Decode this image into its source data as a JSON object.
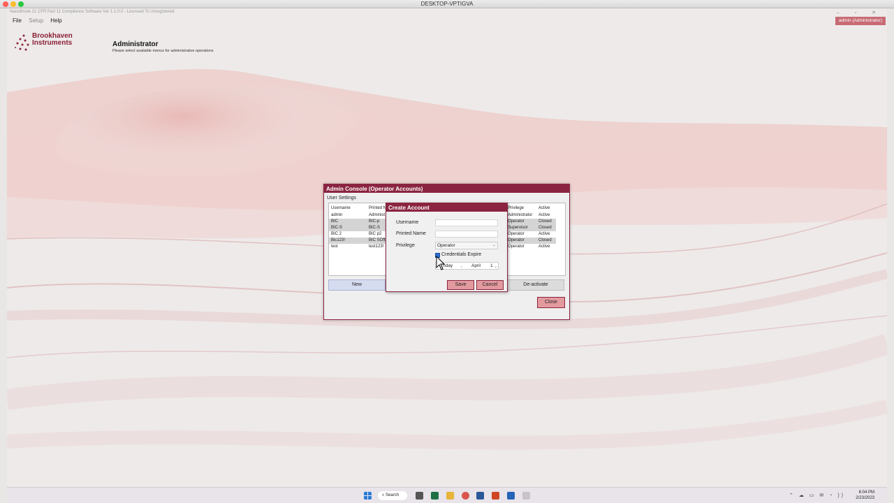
{
  "mac_window": {
    "title": "DESKTOP-VPTIGVA"
  },
  "app": {
    "window_title": "NanoBrook 21 CFR Part 11 Compliance Software Ver 1.1.0.0 - Licensed To Unregistered",
    "window_controls": "– ▫ ✕",
    "menu": {
      "file": "File",
      "setup": "Setup",
      "help": "Help"
    },
    "user_badge": "admin (Administrator)",
    "logo": {
      "line1": "Brookhaven",
      "line2": "Instruments"
    },
    "header": {
      "title": "Administrator",
      "subtitle": "Please select available menus for administrative operations"
    }
  },
  "admin_console": {
    "title": "Admin Console (Operator Accounts)",
    "group_label": "User Settings",
    "columns": {
      "username": "Username",
      "printed_name": "Printed N",
      "privilege": "Privilege",
      "active": "Active"
    },
    "rows": [
      {
        "username": "admin",
        "printed_name": "Administ",
        "privilege": "Administrator",
        "active": "Active"
      },
      {
        "username": "BIC",
        "printed_name": "BIC-p",
        "privilege": "Operator",
        "active": "Closed"
      },
      {
        "username": "BIC-S",
        "printed_name": "BIC-S",
        "privilege": "Supervisor",
        "active": "Closed"
      },
      {
        "username": "BIC 2",
        "printed_name": "BIC p2",
        "privilege": "Operator",
        "active": "Active"
      },
      {
        "username": "Bic123!",
        "printed_name": "BIC SOftw",
        "privilege": "Operator",
        "active": "Closed"
      },
      {
        "username": "test",
        "printed_name": "test123!",
        "privilege": "Operator",
        "active": "Active"
      }
    ],
    "buttons": {
      "new": "New",
      "deactivate": "De-activate",
      "close": "Close"
    }
  },
  "create_account": {
    "title": "Create Account",
    "labels": {
      "username": "Username",
      "printed_name": "Printed Name",
      "privilege": "Privilege"
    },
    "values": {
      "username": "",
      "printed_name": "",
      "privilege": "Operator"
    },
    "credentials_expire_label": "Credentials Expire",
    "credentials_expire_checked": true,
    "date": {
      "weekday": "nday",
      "sep": ",",
      "month": "April",
      "day": "1"
    },
    "buttons": {
      "save": "Save",
      "cancel": "Cancel"
    }
  },
  "taskbar": {
    "search_label": "Search",
    "time": "6:04 PM",
    "date": "2/23/2023",
    "tray_icons": "⌃ ☁ ▭ ✉ ◔ ))"
  }
}
